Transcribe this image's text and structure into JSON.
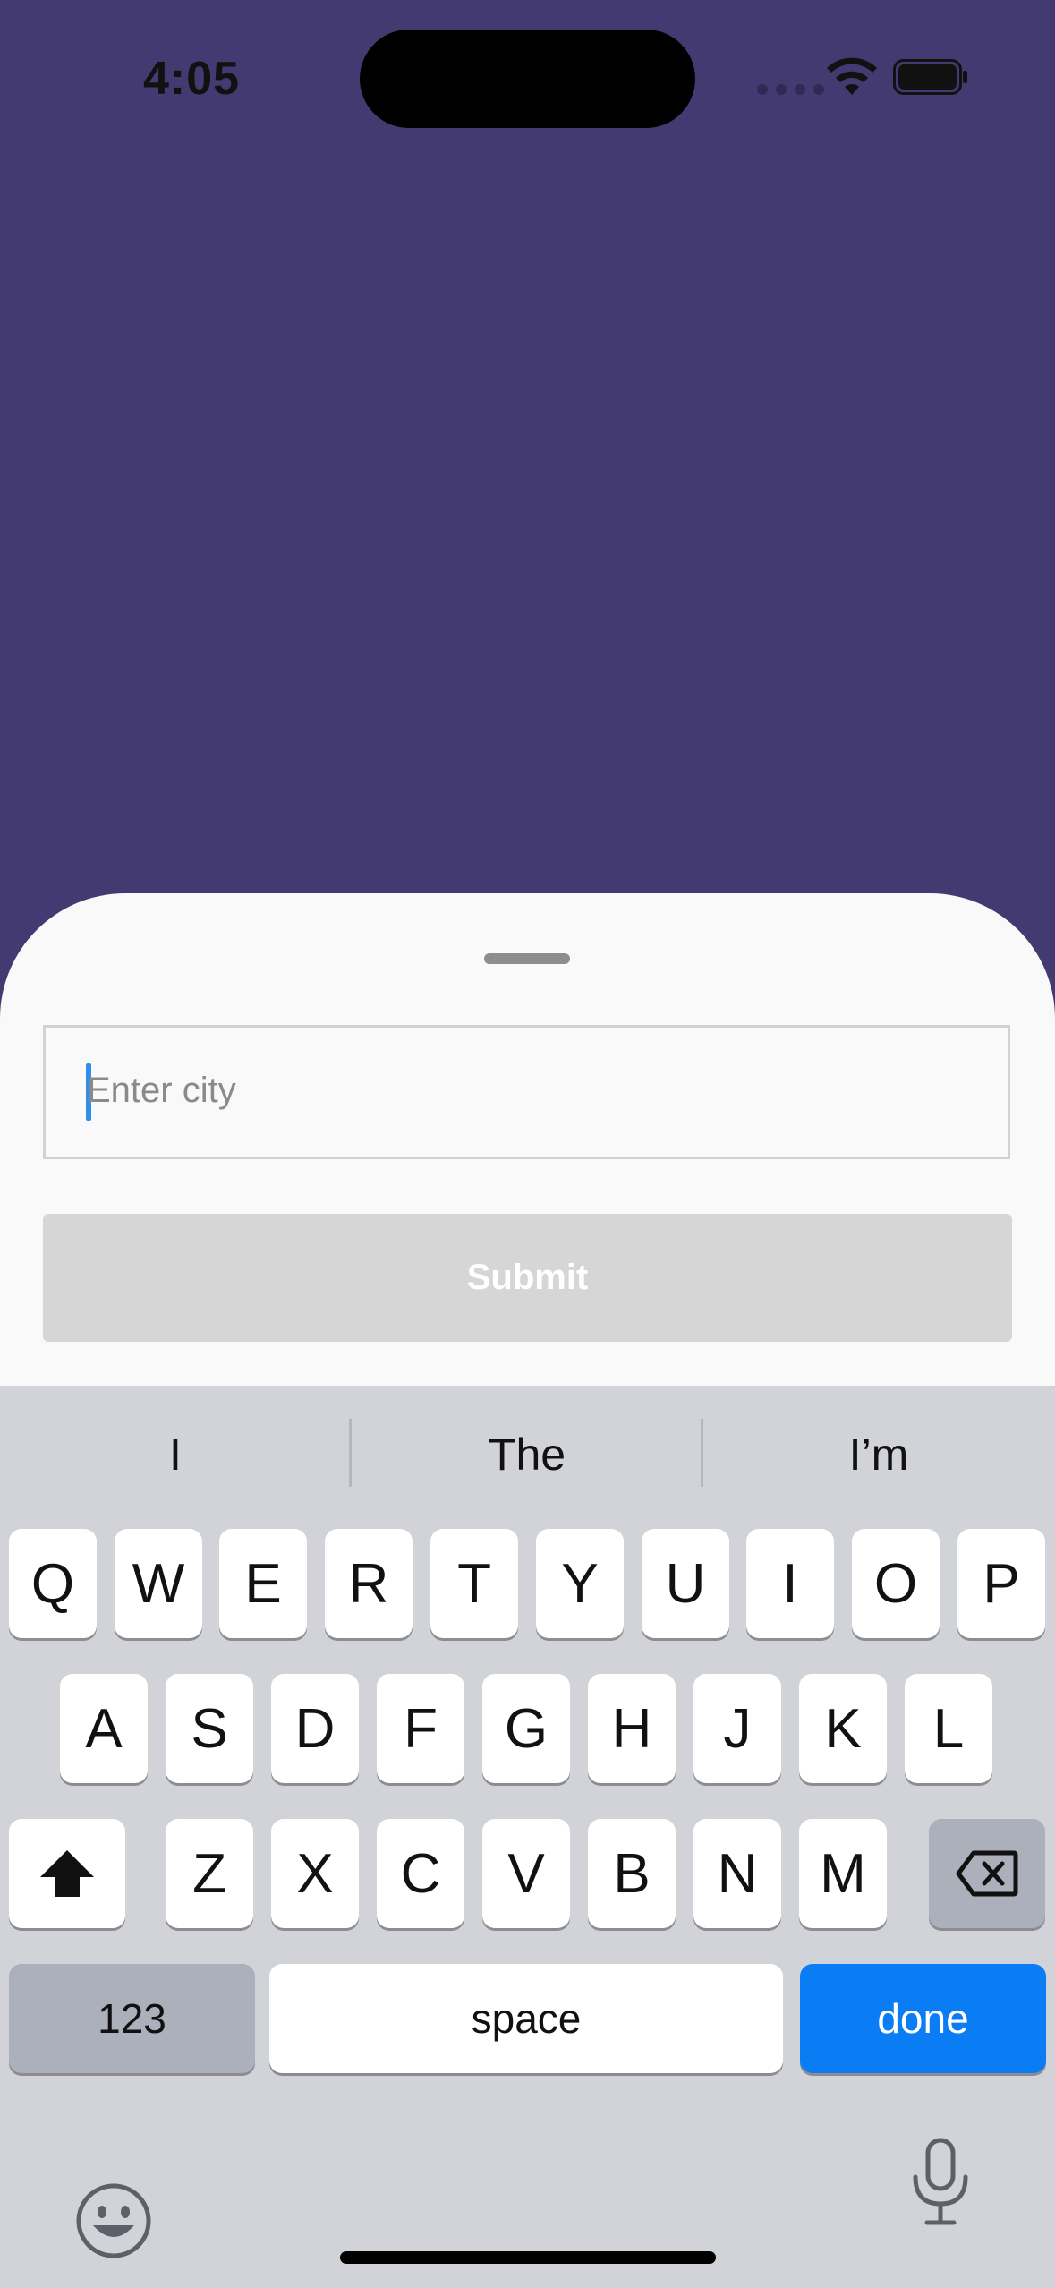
{
  "status_bar": {
    "time": "4:05"
  },
  "sheet": {
    "city_input": {
      "value": "",
      "placeholder": "Enter city"
    },
    "submit_label": "Submit"
  },
  "keyboard": {
    "suggestions": [
      "I",
      "The",
      "I’m"
    ],
    "row1": [
      "Q",
      "W",
      "E",
      "R",
      "T",
      "Y",
      "U",
      "I",
      "O",
      "P"
    ],
    "row2": [
      "A",
      "S",
      "D",
      "F",
      "G",
      "H",
      "J",
      "K",
      "L"
    ],
    "row3": [
      "Z",
      "X",
      "C",
      "V",
      "B",
      "N",
      "M"
    ],
    "numbers_label": "123",
    "space_label": "space",
    "done_label": "done"
  },
  "colors": {
    "background": "#433a72",
    "sheet": "#f9f9f9",
    "keyboard": "#d1d3d9",
    "done_key": "#0a7df5",
    "submit_disabled": "#d6d6d6"
  }
}
